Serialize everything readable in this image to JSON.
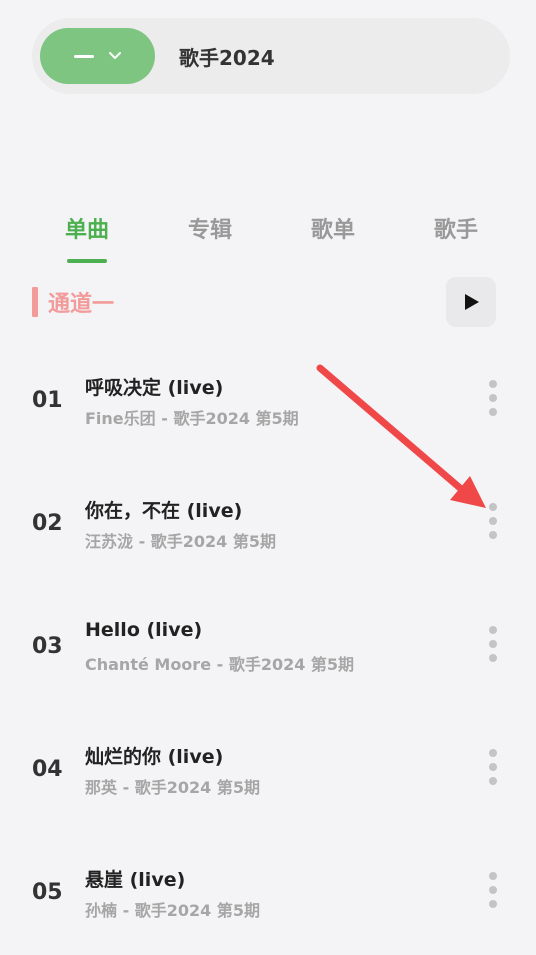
{
  "header": {
    "search_title": "歌手2024",
    "icons": {
      "menu": "menu-dash-icon",
      "dropdown": "chevron-down-icon"
    },
    "accent_color": "#7dc581"
  },
  "tabs": [
    {
      "label": "单曲",
      "active": true
    },
    {
      "label": "专辑",
      "active": false
    },
    {
      "label": "歌单",
      "active": false
    },
    {
      "label": "歌手",
      "active": false
    }
  ],
  "section": {
    "title": "通道一",
    "color": "#f29b9b",
    "play_icon": "play-icon"
  },
  "songs": [
    {
      "num": "01",
      "title": "呼吸决定 (live)",
      "subtitle": "Fine乐团 - 歌手2024 第5期"
    },
    {
      "num": "02",
      "title": "你在，不在 (live)",
      "subtitle": "汪苏泷 - 歌手2024 第5期"
    },
    {
      "num": "03",
      "title": "Hello (live)",
      "subtitle": "Chanté Moore - 歌手2024 第5期"
    },
    {
      "num": "04",
      "title": "灿烂的你 (live)",
      "subtitle": "那英 - 歌手2024 第5期"
    },
    {
      "num": "05",
      "title": "悬崖 (live)",
      "subtitle": "孙楠 - 歌手2024 第5期"
    }
  ],
  "annotation": {
    "arrow_color": "#f04848",
    "icon": "annotation-arrow-icon"
  }
}
